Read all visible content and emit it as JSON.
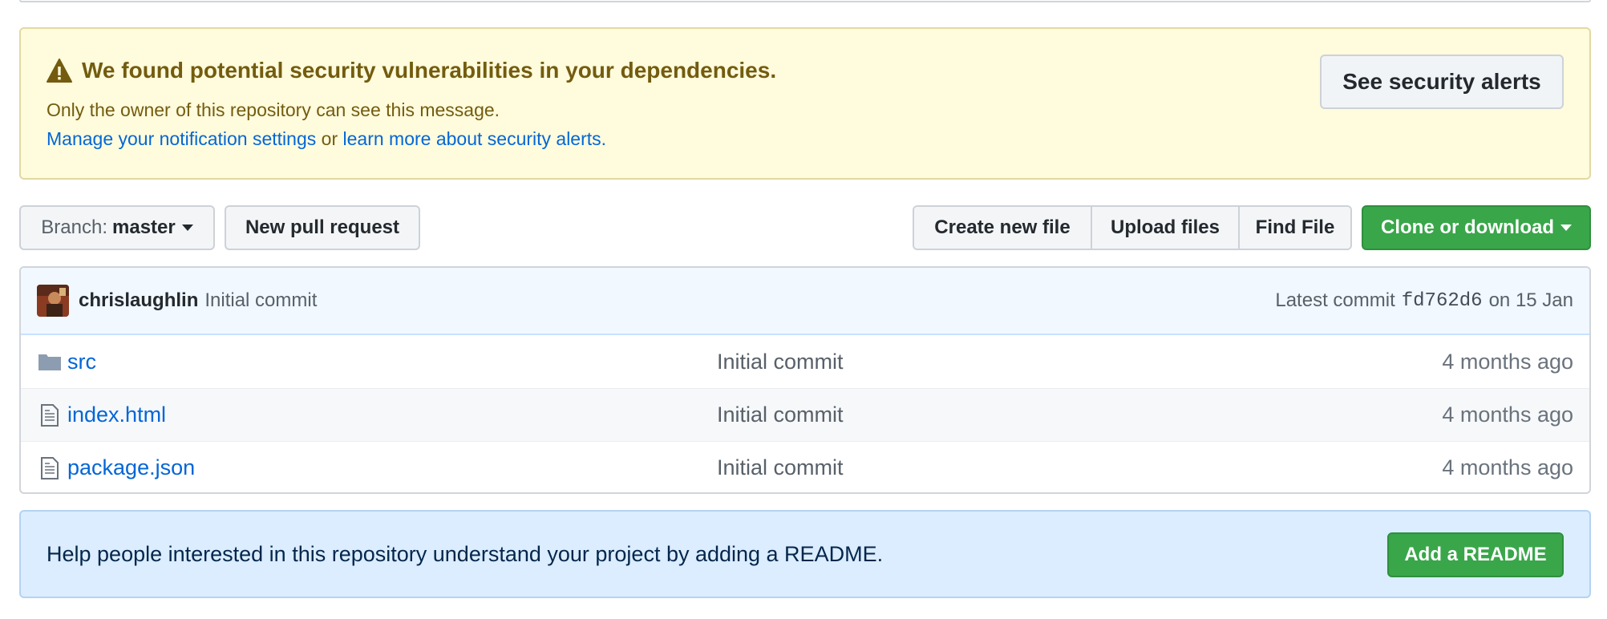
{
  "alert": {
    "title": "We found potential security vulnerabilities in your dependencies.",
    "subtitle": "Only the owner of this repository can see this message.",
    "link_manage": "Manage your notification settings",
    "link_joiner": " or ",
    "link_learn": "learn more about security alerts",
    "link_end": ".",
    "button": "See security alerts",
    "icon": "warning-icon"
  },
  "toolbar": {
    "branch_label": "Branch:",
    "branch_value": "master",
    "new_pr": "New pull request",
    "create_file": "Create new file",
    "upload_files": "Upload files",
    "find_file": "Find File",
    "clone": "Clone or download"
  },
  "commit": {
    "author": "chrislaughlin",
    "message": "Initial commit",
    "latest_label": "Latest commit",
    "sha": "fd762d6",
    "date": "on 15 Jan"
  },
  "files": [
    {
      "name": "src",
      "type": "folder",
      "message": "Initial commit",
      "age": "4 months ago"
    },
    {
      "name": "index.html",
      "type": "file",
      "message": "Initial commit",
      "age": "4 months ago"
    },
    {
      "name": "package.json",
      "type": "file",
      "message": "Initial commit",
      "age": "4 months ago"
    }
  ],
  "readme": {
    "text": "Help people interested in this repository understand your project by adding a README.",
    "button": "Add a README"
  },
  "colors": {
    "link": "#0366d6",
    "alert_bg": "#fffbdd",
    "alert_text": "#735c0f",
    "green": "#39a64a",
    "readme_bg": "#dbedff"
  }
}
